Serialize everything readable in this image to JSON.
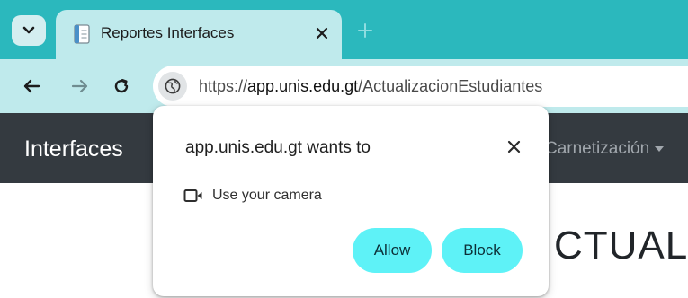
{
  "browser": {
    "tab": {
      "title": "Reportes Interfaces"
    },
    "address_bar": {
      "scheme": "https://",
      "host": "app.unis.edu.gt",
      "path": "/ActualizacionEstudiantes"
    }
  },
  "page": {
    "brand": "Interfaces",
    "nav_link": "Carnetización",
    "heading_partial": "CTUALIZ"
  },
  "permission_prompt": {
    "title": "app.unis.edu.gt wants to",
    "permission_label": "Use your camera",
    "allow_label": "Allow",
    "block_label": "Block"
  },
  "colors": {
    "tab_strip": "#2bb8bd",
    "toolbar": "#bfeaec",
    "navbar": "#343a40",
    "button_fill": "#5ef2f7"
  },
  "icons": {
    "tab_search": "chevron-down-icon",
    "favicon": "document-icon",
    "tab_close": "close-icon",
    "new_tab": "plus-icon",
    "back": "arrow-left-icon",
    "forward": "arrow-right-icon",
    "reload": "reload-icon",
    "site_info": "globe-icon",
    "dialog_close": "close-icon",
    "permission": "camera-icon"
  }
}
